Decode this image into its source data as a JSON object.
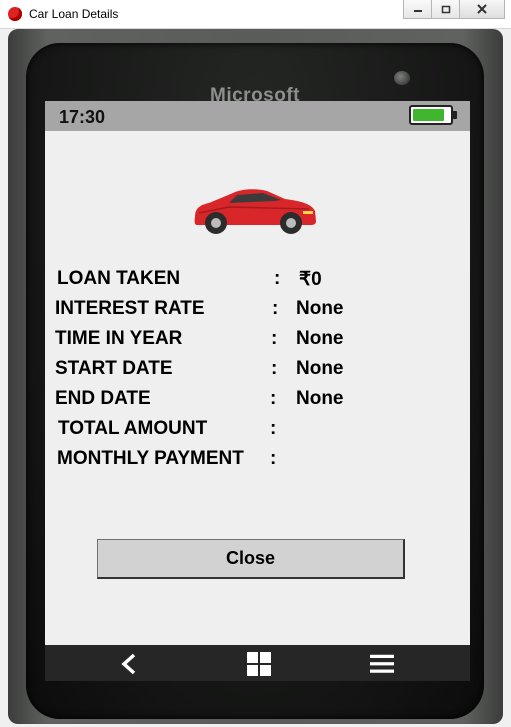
{
  "window": {
    "title": "Car Loan Details",
    "minimize_icon": "minimize-icon",
    "maximize_icon": "restore-icon",
    "close_icon": "close-icon"
  },
  "device": {
    "brand": "Microsoft"
  },
  "statusbar": {
    "time": "17:30",
    "battery_level": 0.85,
    "battery_color": "#3fb62d"
  },
  "car_icon": "car-icon",
  "details": [
    {
      "label": "LOAN TAKEN",
      "sep": ":",
      "value": "₹0"
    },
    {
      "label": "INTEREST RATE",
      "sep": ":",
      "value": "None"
    },
    {
      "label": "TIME IN YEAR",
      "sep": ":",
      "value": "None"
    },
    {
      "label": "START DATE",
      "sep": ":",
      "value": "None"
    },
    {
      "label": "END DATE",
      "sep": ":",
      "value": "None"
    },
    {
      "label": "TOTAL AMOUNT",
      "sep": ":",
      "value": ""
    },
    {
      "label": "MONTHLY PAYMENT",
      "sep": ":",
      "value": ""
    }
  ],
  "close_button": {
    "label": "Close"
  },
  "navbar": {
    "back_icon": "back-icon",
    "windows_icon": "windows-icon",
    "menu_icon": "menu-icon"
  },
  "colors": {
    "car_red": "#d8262a",
    "statusbar_bg": "#a6a6a6",
    "screen_bg": "#efefef"
  }
}
